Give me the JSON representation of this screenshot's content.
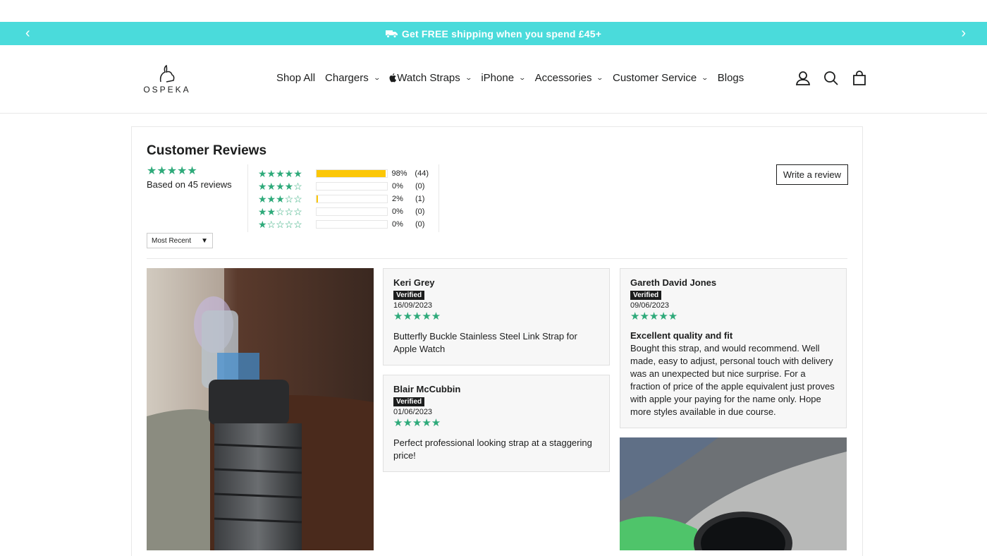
{
  "announcement": {
    "text": "Get FREE shipping when you spend £45+",
    "prev_icon": "chevron-left-icon",
    "next_icon": "chevron-right-icon",
    "bg": "#4adbdb"
  },
  "header": {
    "logo_text": "OSPEKA",
    "nav": [
      {
        "label": "Shop All",
        "dropdown": false
      },
      {
        "label": "Chargers",
        "dropdown": true
      },
      {
        "label": "Watch Straps",
        "dropdown": true
      },
      {
        "label": "iPhone",
        "dropdown": true
      },
      {
        "label": "Accessories",
        "dropdown": true
      },
      {
        "label": "Customer Service",
        "dropdown": true
      },
      {
        "label": "Blogs",
        "dropdown": false
      }
    ],
    "icons": [
      "account-icon",
      "search-icon",
      "cart-icon"
    ]
  },
  "reviews": {
    "title": "Customer Reviews",
    "average_stars": 5,
    "based_on": "Based on 45 reviews",
    "write_review": "Write a review",
    "sort_selected": "Most Recent",
    "histogram": [
      {
        "stars": 5,
        "percent": 98,
        "pct_label": "98%",
        "count_label": "(44)"
      },
      {
        "stars": 4,
        "percent": 0,
        "pct_label": "0%",
        "count_label": "(0)"
      },
      {
        "stars": 3,
        "percent": 2,
        "pct_label": "2%",
        "count_label": "(1)"
      },
      {
        "stars": 2,
        "percent": 0,
        "pct_label": "0%",
        "count_label": "(0)"
      },
      {
        "stars": 1,
        "percent": 0,
        "pct_label": "0%",
        "count_label": "(0)"
      }
    ],
    "items": [
      {
        "name": "Keri Grey",
        "badge": "Verified",
        "date": "16/09/2023",
        "stars": 5,
        "title": "",
        "body": "Butterfly Buckle Stainless Steel Link Strap for Apple Watch"
      },
      {
        "name": "Blair McCubbin",
        "badge": "Verified",
        "date": "01/06/2023",
        "stars": 5,
        "title": "",
        "body": "Perfect professional looking strap at a staggering price!"
      },
      {
        "name": "Gareth David Jones",
        "badge": "Verified",
        "date": "09/06/2023",
        "stars": 5,
        "title": "Excellent quality and fit",
        "body": "Bought this strap, and would recommend. Well made, easy to adjust, personal touch with delivery was an unexpected but nice surprise. For a fraction of price of the apple equivalent just proves with apple your paying for the name only. Hope more styles available in due course."
      }
    ],
    "star_color": "#2eaa7a",
    "bar_color": "#fcc706"
  }
}
